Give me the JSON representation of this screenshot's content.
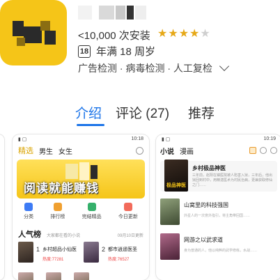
{
  "app": {
    "installs": "<10,000 次安装",
    "rating_stars": 3.5,
    "rating_max": 5,
    "age_badge": "18",
    "age_text": "年满 18 周岁",
    "checks_text": "广告检测 · 病毒检测 · 人工复检",
    "icon": {
      "name": "app-icon",
      "primary_color": "#f5c518"
    },
    "name_mosaic_colors": [
      "#f2f2f2",
      "#d9d9d9",
      "#c8c8c8",
      "#333333",
      "#eeeeee"
    ]
  },
  "tabs": [
    {
      "label": "介绍",
      "active": true
    },
    {
      "label": "评论 (27)",
      "active": false
    },
    {
      "label": "推荐",
      "active": false
    }
  ],
  "accent_color": "#1a73e8",
  "screenshots": {
    "mid": {
      "status_time": "10:18",
      "nav": [
        "精选",
        "男生",
        "女生"
      ],
      "banner_text": "阅读就能赚钱",
      "quick_links": [
        {
          "label": "分类",
          "color": "#3d7bf5"
        },
        {
          "label": "排行榜",
          "color": "#f0a030"
        },
        {
          "label": "完结精品",
          "color": "#35b06b"
        },
        {
          "label": "今日更新",
          "color": "#f26b5b"
        }
      ],
      "rank_title": "人气榜",
      "rank_sub": "大家都在看的小说",
      "rank_date": "09月10日更新",
      "books": [
        {
          "rank": "1",
          "title": "乡村超品小仙医",
          "hot": "热度:77281"
        },
        {
          "rank": "2",
          "title": "都市逍遥医圣",
          "hot": "热度:76527"
        }
      ]
    },
    "right": {
      "status_time": "10:19",
      "nav": [
        "小说",
        "漫画"
      ],
      "hero": {
        "cover_text": "极品神医",
        "title": "乡村极品神医",
        "desc": "三年前，赵阳在镇医院被人陷害入狱，三年后，他出狱回到村中，用精湛医术为村民治病，更兼获取修仙之门……"
      },
      "list": [
        {
          "title": "山窝里的科技强国",
          "desc": "外星人的一次意外指引，将主角带回国……",
          "cover": "#6b7d5a"
        },
        {
          "title": "网游之以武求道",
          "desc": "身为普通的人，他以纯粹的武学修练，水战……",
          "cover": "#8a4a6a"
        }
      ]
    }
  }
}
